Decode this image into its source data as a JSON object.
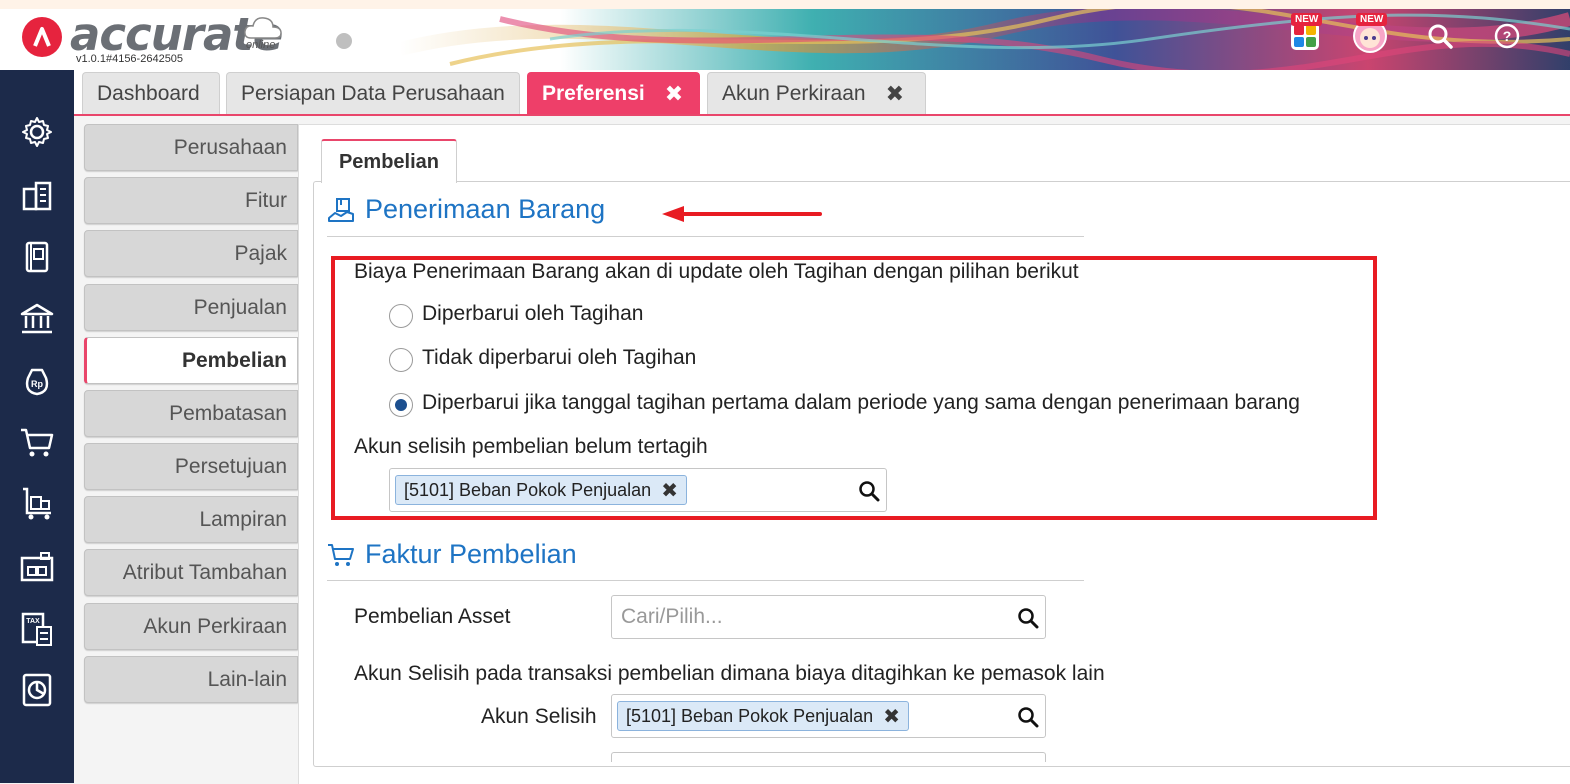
{
  "header": {
    "logo_text": "accurate",
    "logo_sub": "online",
    "version": "v1.0.1#4156-2642505",
    "new_badge": "NEW",
    "new_badge2": "NEW"
  },
  "tabs": [
    {
      "label": "Dashboard"
    },
    {
      "label": "Persiapan Data Perusahaan"
    },
    {
      "label": "Preferensi",
      "active": true
    },
    {
      "label": "Akun Perkiraan"
    }
  ],
  "pref_nav": [
    "Perusahaan",
    "Fitur",
    "Pajak",
    "Penjualan",
    "Pembelian",
    "Pembatasan",
    "Persetujuan",
    "Lampiran",
    "Atribut Tambahan",
    "Akun Perkiraan",
    "Lain-lain"
  ],
  "panel": {
    "subtab": "Pembelian",
    "section1": {
      "title": "Penerimaan Barang",
      "question": "Biaya Penerimaan Barang akan di update oleh Tagihan dengan pilihan berikut",
      "options": [
        "Diperbarui oleh Tagihan",
        "Tidak diperbarui oleh Tagihan",
        "Diperbarui jika tanggal tagihan pertama dalam periode yang sama dengan penerimaan barang"
      ],
      "selected_index": 2,
      "account_label": "Akun selisih pembelian belum tertagih",
      "account_value": "[5101] Beban Pokok Penjualan"
    },
    "section2": {
      "title": "Faktur Pembelian",
      "asset_label": "Pembelian Asset",
      "asset_placeholder": "Cari/Pilih...",
      "diff_desc": "Akun Selisih pada transaksi pembelian dimana biaya ditagihkan ke pemasok lain",
      "diff_label": "Akun Selisih",
      "diff_value": "[5101] Beban Pokok Penjualan"
    }
  },
  "colors": {
    "accent": "#ee3f69",
    "link_blue": "#1e74c4",
    "rail": "#1c2a4a",
    "highlight_red": "#e81b22"
  }
}
